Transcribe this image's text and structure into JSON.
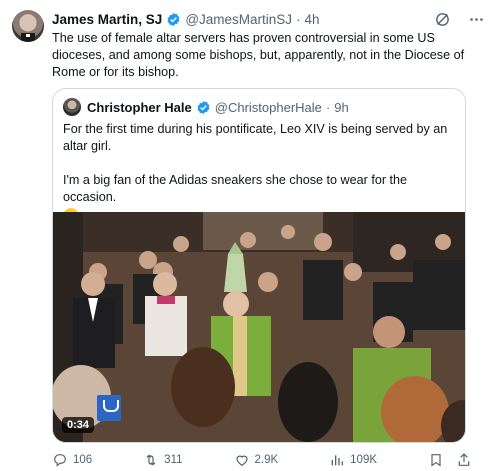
{
  "tweet": {
    "author_name": "James Martin, SJ",
    "author_handle": "@JamesMartinSJ",
    "separator": "·",
    "time": "4h",
    "text": "The use of female altar servers has proven controversial in some US dioceses, and among some bishops, but, apparently, not in the Diocese of Rome or for its bishop."
  },
  "quote": {
    "author_name": "Christopher Hale",
    "author_handle": "@ChristopherHale",
    "separator": "·",
    "time": "9h",
    "paragraph_1": "For the first time during his pontificate, Leo XIV is being served by an altar girl.",
    "paragraph_2": "I'm a big fan of the Adidas sneakers she chose to wear for the occasion.",
    "emoji": "sunglasses-emoji",
    "video_duration": "0:34"
  },
  "footer": {
    "replies": "106",
    "reposts": "311",
    "likes": "2.9K",
    "views": "109K"
  },
  "colors": {
    "verified": "#1d9bf0",
    "text": "#0f1419",
    "muted": "#536471",
    "border": "#cfd9de"
  },
  "icons": [
    "grok-icon",
    "more-icon",
    "verified-icon",
    "reply-icon",
    "repost-icon",
    "like-icon",
    "views-icon",
    "bookmark-icon",
    "share-icon"
  ]
}
